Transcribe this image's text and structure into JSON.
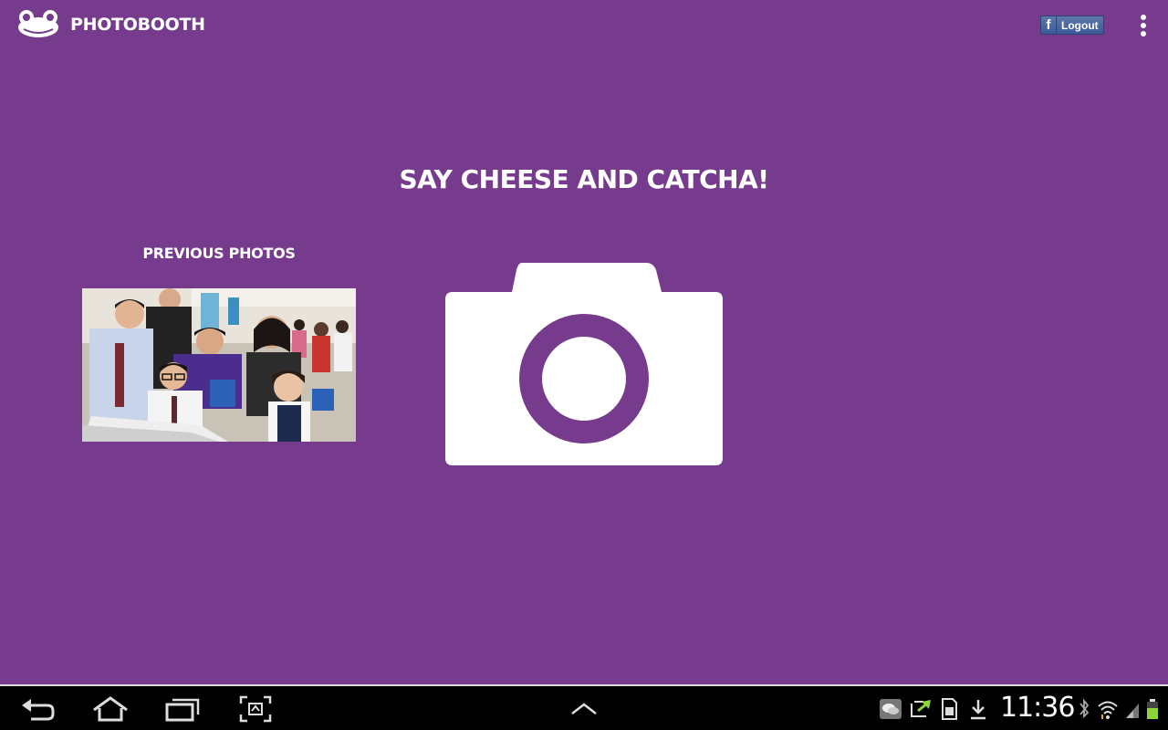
{
  "app": {
    "title": "PHOTOBOOTH",
    "logo_icon": "frog-logo-icon"
  },
  "actionbar": {
    "facebook_icon_glyph": "f",
    "logout_label": "Logout",
    "menu_icon": "overflow-menu-icon"
  },
  "main": {
    "headline": "SAY CHEESE AND CATCHA!",
    "previous_label": "PREVIOUS PHOTOS",
    "camera_icon": "camera-icon"
  },
  "system_bar": {
    "time": "11:36",
    "nav_icons": [
      "back-icon",
      "home-icon",
      "recent-apps-icon",
      "screenshot-icon",
      "up-arrow-icon"
    ],
    "status_icons": [
      "chat-notification-icon",
      "sync-icon",
      "sd-card-icon",
      "download-icon",
      "bluetooth-icon",
      "wifi-icon",
      "signal-icon",
      "battery-icon"
    ]
  },
  "colors": {
    "background": "#763b8c",
    "foreground": "#ffffff",
    "facebook_blue": "#3b5998"
  }
}
